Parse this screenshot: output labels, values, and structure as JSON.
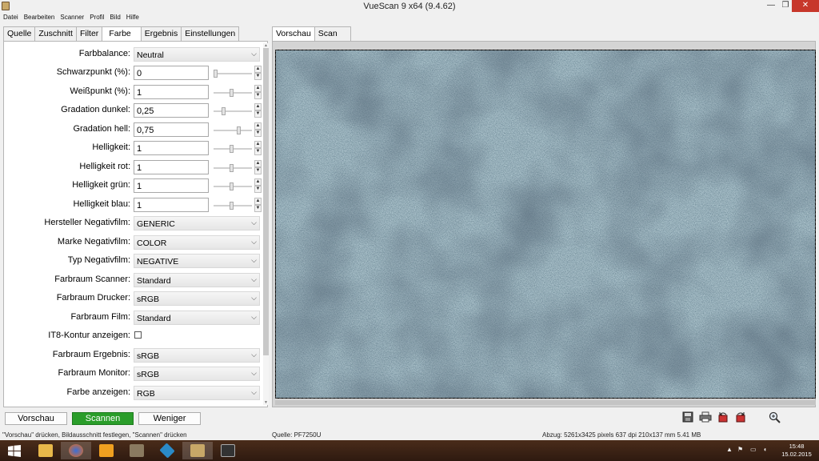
{
  "window": {
    "title": "VueScan 9 x64 (9.4.62)",
    "min_glyph": "—",
    "max_glyph": "❐",
    "close_glyph": "✕"
  },
  "menu": [
    "Datei",
    "Bearbeiten",
    "Scanner",
    "Profil",
    "Bild",
    "Hilfe"
  ],
  "left_tabs": [
    "Quelle",
    "Zuschnitt",
    "Filter",
    "Farbe",
    "Ergebnis",
    "Einstellungen"
  ],
  "active_left_tab": "Farbe",
  "right_tabs": [
    "Vorschau",
    "Scan"
  ],
  "active_right_tab": "Vorschau",
  "settings": {
    "farbbalance": {
      "label": "Farbbalance:",
      "value": "Neutral"
    },
    "schwarzpunkt": {
      "label": "Schwarzpunkt (%):",
      "value": "0"
    },
    "weisspunkt": {
      "label": "Weißpunkt (%):",
      "value": "1"
    },
    "gradation_dunkel": {
      "label": "Gradation dunkel:",
      "value": "0,25"
    },
    "gradation_hell": {
      "label": "Gradation hell:",
      "value": "0,75"
    },
    "helligkeit": {
      "label": "Helligkeit:",
      "value": "1"
    },
    "helligkeit_rot": {
      "label": "Helligkeit rot:",
      "value": "1"
    },
    "helligkeit_gruen": {
      "label": "Helligkeit grün:",
      "value": "1"
    },
    "helligkeit_blau": {
      "label": "Helligkeit blau:",
      "value": "1"
    },
    "hersteller_negativfilm": {
      "label": "Hersteller Negativfilm:",
      "value": "GENERIC"
    },
    "marke_negativfilm": {
      "label": "Marke Negativfilm:",
      "value": "COLOR"
    },
    "typ_negativfilm": {
      "label": "Typ Negativfilm:",
      "value": "NEGATIVE"
    },
    "farbraum_scanner": {
      "label": "Farbraum Scanner:",
      "value": "Standard"
    },
    "farbraum_drucker": {
      "label": "Farbraum Drucker:",
      "value": "sRGB"
    },
    "farbraum_film": {
      "label": "Farbraum Film:",
      "value": "Standard"
    },
    "it8_kontur": {
      "label": "IT8-Kontur anzeigen:",
      "checked": false
    },
    "farbraum_ergebnis": {
      "label": "Farbraum Ergebnis:",
      "value": "sRGB"
    },
    "farbraum_monitor": {
      "label": "Farbraum Monitor:",
      "value": "sRGB"
    },
    "farbe_anzeigen": {
      "label": "Farbe anzeigen:",
      "value": "RGB"
    }
  },
  "buttons": {
    "vorschau": "Vorschau",
    "scannen": "Scannen",
    "weniger": "Weniger"
  },
  "status": {
    "hint": "\"Vorschau\" drücken, Bildausschnitt festlegen, \"Scannen\" drücken",
    "quelle": "Quelle: PF7250U",
    "abzug": "Abzug: 5261x3425 pixels 637 dpi 210x137 mm 5.41 MB"
  },
  "taskbar": {
    "time": "15:48",
    "date": "15.02.2015"
  },
  "colors": {
    "scan_button": "#2a9d2a",
    "close_button": "#c7372b",
    "taskbar": "#3b2215"
  }
}
